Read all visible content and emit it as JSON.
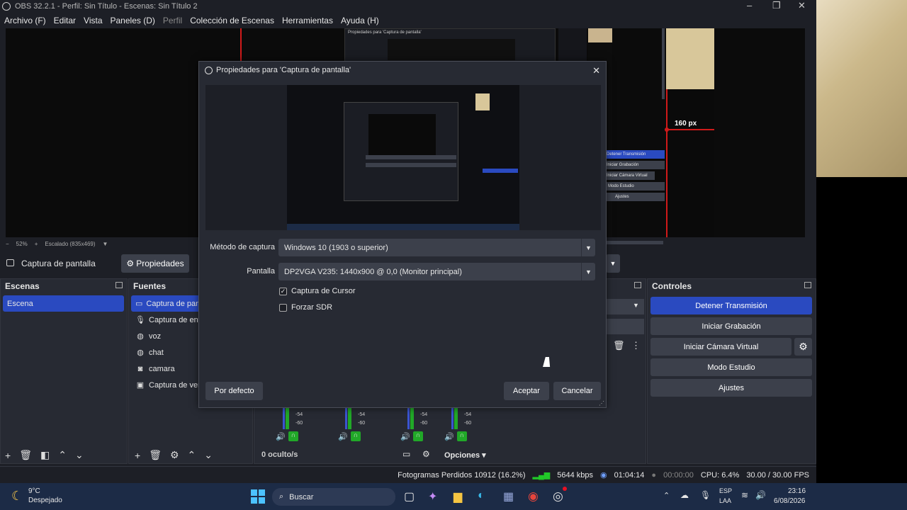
{
  "window": {
    "title": "OBS 32.2.1 - Perfil: Sin Título - Escenas: Sin Título 2"
  },
  "menu": [
    "Archivo (F)",
    "Editar",
    "Vista",
    "Paneles (D)",
    "Perfil",
    "Colección de Escenas",
    "Herramientas",
    "Ayuda (H)"
  ],
  "preview": {
    "measure_label": "160 px",
    "zoom": "52%",
    "scale_label": "Escalado (835x469)",
    "nested_dialog_title": "Propiedades para 'Captura de pantalla'"
  },
  "source_bar": {
    "selected_source": "Captura de pantalla",
    "properties_label": "Propiedades"
  },
  "scenes": {
    "title": "Escenas",
    "items": [
      "Escena"
    ]
  },
  "sources": {
    "title": "Fuentes",
    "items": [
      {
        "label": "Captura de pan",
        "icon": "monitor-icon"
      },
      {
        "label": "Captura de ent",
        "icon": "microphone-icon"
      },
      {
        "label": "voz",
        "icon": "globe-icon"
      },
      {
        "label": "chat",
        "icon": "globe-icon"
      },
      {
        "label": "camara",
        "icon": "camera-icon"
      },
      {
        "label": "Captura de ven",
        "icon": "window-icon"
      }
    ]
  },
  "mixer": {
    "hidden_label": "0 oculto/s",
    "options_label": "Opciones",
    "db_labels": [
      "-54",
      "-60"
    ]
  },
  "controls": {
    "title": "Controles",
    "stop_stream": "Detener Transmisión",
    "start_record": "Iniciar Grabación",
    "start_vcam": "Iniciar Cámara Virtual",
    "studio_mode": "Modo Estudio",
    "settings": "Ajustes",
    "accent": "#2a4ac0"
  },
  "status": {
    "dropped_frames": "Fotogramas Perdidos 10912 (16.2%)",
    "bitrate": "5644 kbps",
    "stream_time": "01:04:14",
    "record_time": "00:00:00",
    "cpu": "CPU: 6.4%",
    "fps": "30.00 / 30.00 FPS"
  },
  "dialog": {
    "title": "Propiedades para 'Captura de pantalla'",
    "method_label": "Método de captura",
    "method_value": "Windows 10 (1903 o superior)",
    "display_label": "Pantalla",
    "display_value": "DP2VGA V235: 1440x900 @ 0,0 (Monitor principal)",
    "cursor_label": "Captura de Cursor",
    "cursor_checked": true,
    "sdr_label": "Forzar SDR",
    "sdr_checked": false,
    "defaults_button": "Por defecto",
    "accept_button": "Aceptar",
    "cancel_button": "Cancelar"
  },
  "taskbar": {
    "weather_temp": "9°C",
    "weather_desc": "Despejado",
    "search_placeholder": "Buscar",
    "lang_top": "ESP",
    "lang_bottom": "LAA",
    "time": "23:16",
    "date": "6/08/2026"
  }
}
